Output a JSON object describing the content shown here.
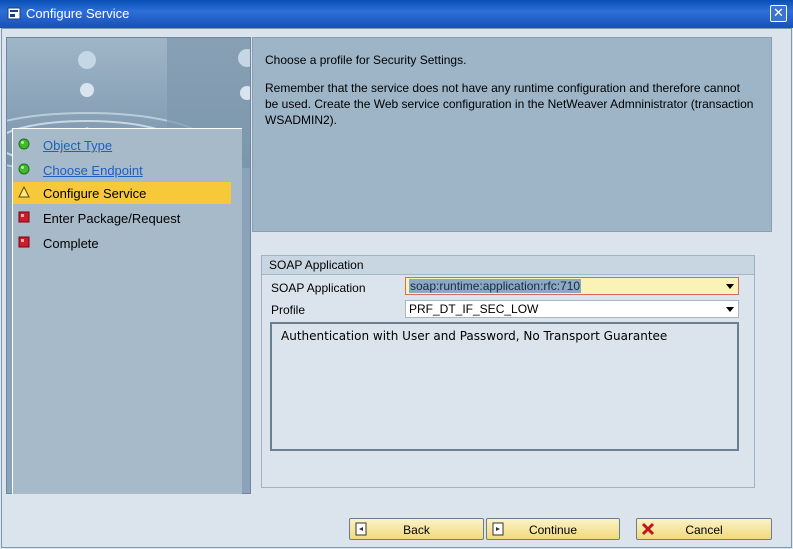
{
  "window": {
    "title": "Configure Service",
    "close_glyph": "✕"
  },
  "steps": [
    {
      "label": "Object Type",
      "state": "done",
      "icon": "green-circle-icon"
    },
    {
      "label": "Choose Endpoint",
      "state": "done",
      "icon": "green-circle-icon"
    },
    {
      "label": "Configure Service",
      "state": "current",
      "icon": "warning-triangle-icon"
    },
    {
      "label": "Enter Package/Request",
      "state": "pending",
      "icon": "red-square-icon"
    },
    {
      "label": "Complete",
      "state": "pending",
      "icon": "red-square-icon"
    }
  ],
  "message": {
    "line1": "Choose a profile for Security Settings.",
    "line2": "Remember that the service does not have any runtime configuration and therefore cannot be used. Create the Web service configuration in the NetWeaver Admninistrator (transaction WSADMIN2)."
  },
  "soap_group": {
    "title": "SOAP Application",
    "soap_label": "SOAP Application",
    "soap_value": "soap:runtime:application:rfc:710",
    "profile_label": "Profile",
    "profile_value": "PRF_DT_IF_SEC_LOW",
    "description": "Authentication with User and Password, No Transport Guarantee"
  },
  "buttons": {
    "back": "Back",
    "continue": "Continue",
    "cancel": "Cancel"
  },
  "colors": {
    "title_bar": "#1850b9",
    "active_step": "#f7c93a",
    "link": "#1f5fc0",
    "button": "#f1d97a"
  }
}
